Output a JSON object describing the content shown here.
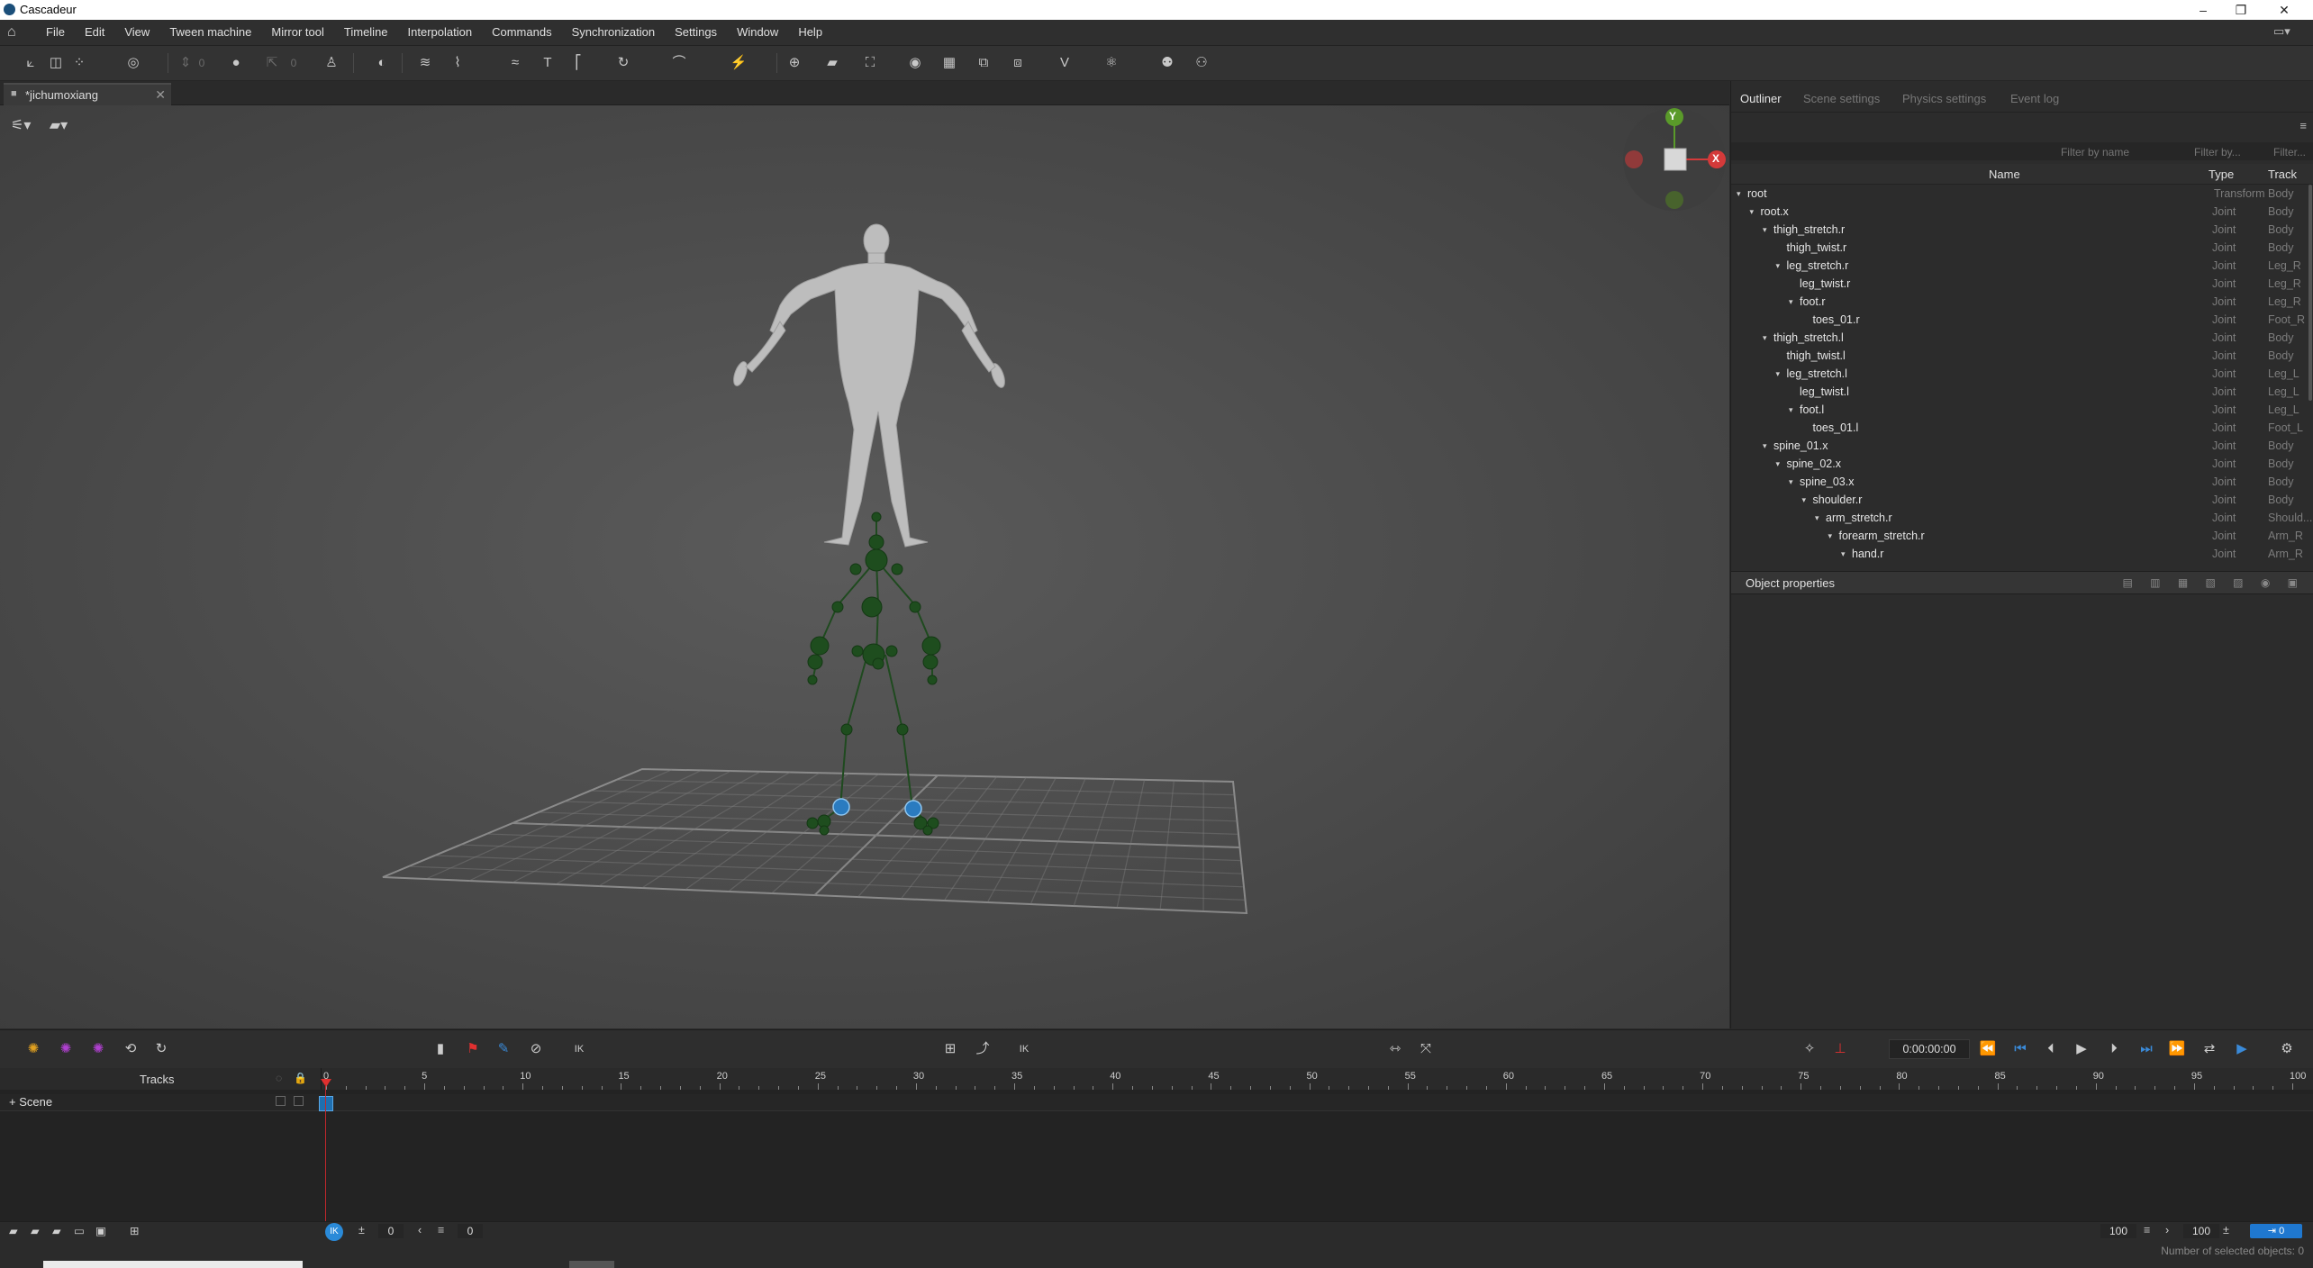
{
  "window": {
    "title": "Cascadeur",
    "controls": [
      "–",
      "❐",
      "✕"
    ]
  },
  "menu": [
    "File",
    "Edit",
    "View",
    "Tween machine",
    "Mirror tool",
    "Timeline",
    "Interpolation",
    "Commands",
    "Synchronization",
    "Settings",
    "Window",
    "Help"
  ],
  "document_tab": {
    "label": "*jichumoxiang",
    "close": "✕"
  },
  "toolbar": {
    "value_a": "0",
    "value_b": "0"
  },
  "gizmo": {
    "y": "Y",
    "x": "X"
  },
  "right_panel": {
    "tabs": [
      "Outliner",
      "Scene settings",
      "Physics settings",
      "Event log"
    ],
    "filter_name_placeholder": "Filter by name",
    "filter_by_placeholder": "Filter by...",
    "filter_2_placeholder": "Filter...",
    "columns": {
      "name": "Name",
      "type": "Type",
      "track": "Track"
    },
    "rows": [
      {
        "name": "root",
        "depth": 0,
        "expanded": true,
        "type": "Transform",
        "track": "Body"
      },
      {
        "name": "root.x",
        "depth": 1,
        "expanded": true,
        "type": "Joint",
        "track": "Body"
      },
      {
        "name": "thigh_stretch.r",
        "depth": 2,
        "expanded": true,
        "type": "Joint",
        "track": "Body"
      },
      {
        "name": "thigh_twist.r",
        "depth": 3,
        "expanded": false,
        "type": "Joint",
        "track": "Body"
      },
      {
        "name": "leg_stretch.r",
        "depth": 3,
        "expanded": true,
        "type": "Joint",
        "track": "Leg_R"
      },
      {
        "name": "leg_twist.r",
        "depth": 4,
        "expanded": false,
        "type": "Joint",
        "track": "Leg_R"
      },
      {
        "name": "foot.r",
        "depth": 4,
        "expanded": true,
        "type": "Joint",
        "track": "Leg_R"
      },
      {
        "name": "toes_01.r",
        "depth": 5,
        "expanded": false,
        "type": "Joint",
        "track": "Foot_R"
      },
      {
        "name": "thigh_stretch.l",
        "depth": 2,
        "expanded": true,
        "type": "Joint",
        "track": "Body"
      },
      {
        "name": "thigh_twist.l",
        "depth": 3,
        "expanded": false,
        "type": "Joint",
        "track": "Body"
      },
      {
        "name": "leg_stretch.l",
        "depth": 3,
        "expanded": true,
        "type": "Joint",
        "track": "Leg_L"
      },
      {
        "name": "leg_twist.l",
        "depth": 4,
        "expanded": false,
        "type": "Joint",
        "track": "Leg_L"
      },
      {
        "name": "foot.l",
        "depth": 4,
        "expanded": true,
        "type": "Joint",
        "track": "Leg_L"
      },
      {
        "name": "toes_01.l",
        "depth": 5,
        "expanded": false,
        "type": "Joint",
        "track": "Foot_L"
      },
      {
        "name": "spine_01.x",
        "depth": 2,
        "expanded": true,
        "type": "Joint",
        "track": "Body"
      },
      {
        "name": "spine_02.x",
        "depth": 3,
        "expanded": true,
        "type": "Joint",
        "track": "Body"
      },
      {
        "name": "spine_03.x",
        "depth": 4,
        "expanded": true,
        "type": "Joint",
        "track": "Body"
      },
      {
        "name": "shoulder.r",
        "depth": 5,
        "expanded": true,
        "type": "Joint",
        "track": "Body"
      },
      {
        "name": "arm_stretch.r",
        "depth": 6,
        "expanded": true,
        "type": "Joint",
        "track": "Should..."
      },
      {
        "name": "forearm_stretch.r",
        "depth": 7,
        "expanded": true,
        "type": "Joint",
        "track": "Arm_R"
      },
      {
        "name": "hand.r",
        "depth": 8,
        "expanded": true,
        "type": "Joint",
        "track": "Arm_R"
      }
    ],
    "object_properties": "Object properties"
  },
  "timeline_toolbar": {
    "time": "0:00:00:00"
  },
  "timeline": {
    "tracks_label": "Tracks",
    "scene_label": "Scene",
    "ruler": [
      "0",
      "5",
      "10",
      "15",
      "20",
      "25",
      "30",
      "35",
      "40",
      "45",
      "50",
      "55",
      "60",
      "65",
      "70",
      "75",
      "80",
      "85",
      "90",
      "95",
      "100"
    ]
  },
  "bottom": {
    "current_frame": "0",
    "frame_field": "0",
    "end_a": "100",
    "end_b": "100",
    "counter": "0",
    "ik_label": "IK"
  },
  "status": {
    "selected": "Number of selected objects: 0"
  },
  "colors": {
    "accent": "#1f6fb0",
    "playhead": "#e0302f",
    "joint_green": "#1e4d1e",
    "joint_blue": "#2a7bc0",
    "gizmo_x": "#d43a3a",
    "gizmo_y": "#5a9a2a"
  }
}
